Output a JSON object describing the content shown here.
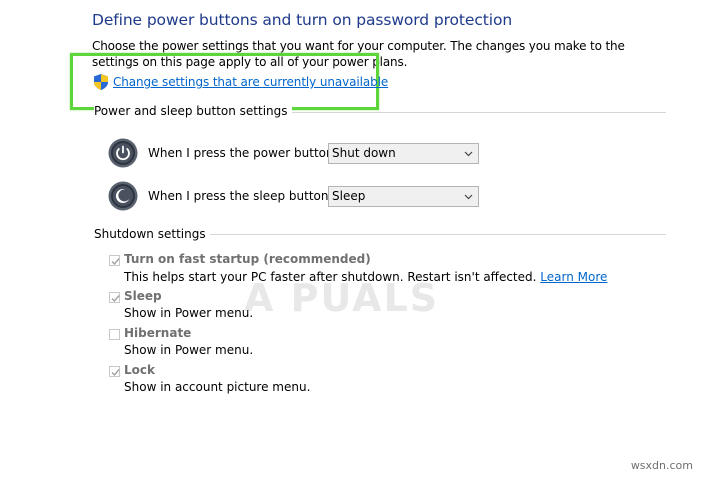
{
  "header": {
    "title": "Define power buttons and turn on password protection",
    "intro": "Choose the power settings that you want for your computer. The changes you make to the settings on this page apply to all of your power plans.",
    "change_link": "Change settings that are currently unavailable"
  },
  "power_sleep": {
    "group_label": "Power and sleep button settings",
    "power_button": {
      "label": "When I press the power button:",
      "selected": "Shut down"
    },
    "sleep_button": {
      "label": "When I press the sleep button:",
      "selected": "Sleep"
    }
  },
  "shutdown": {
    "group_label": "Shutdown settings",
    "options": [
      {
        "title": "Turn on fast startup (recommended)",
        "checked": true,
        "desc": "This helps start your PC faster after shutdown. Restart isn't affected.",
        "link": "Learn More"
      },
      {
        "title": "Sleep",
        "checked": true,
        "desc": "Show in Power menu."
      },
      {
        "title": "Hibernate",
        "checked": false,
        "desc": "Show in Power menu."
      },
      {
        "title": "Lock",
        "checked": true,
        "desc": "Show in account picture menu."
      }
    ]
  },
  "watermark": "A PUALS",
  "footer": "wsxdn.com",
  "colors": {
    "accent": "#1e3a8a",
    "link": "#0066cc",
    "highlight": "#5dd63b"
  }
}
